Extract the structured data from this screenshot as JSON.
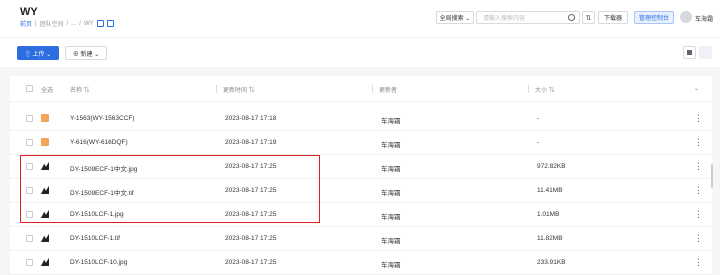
{
  "header": {
    "title": "WY",
    "breadcrumb": [
      "前页",
      "|",
      "团队空间",
      "/",
      "...",
      "/",
      "WY"
    ],
    "search_scope": "全局搜索 ⌄",
    "search_placeholder": "请输入搜索内容",
    "filter_label": "⇅",
    "download_label": "下载器",
    "admin_label": "管理控制台",
    "user_name": "车海霜"
  },
  "toolbar": {
    "upload_label": "⇧ 上传 ⌄",
    "new_label": "⊕ 新建 ⌄"
  },
  "table": {
    "headers": {
      "select_all": "全选",
      "name": "名称 ⇅",
      "updated": "更新时间 ⇅",
      "updater": "更新者",
      "size": "大小 ⇅",
      "more": "⌄"
    },
    "rows": [
      {
        "icon": "folder-icon",
        "name": "Y-1563(WY-1563CCF)",
        "updated": "2023-08-17 17:18",
        "updater": "车海霜",
        "size": "-"
      },
      {
        "icon": "folder-icon",
        "name": "Y-616(WY-616DQF)",
        "updated": "2023-08-17 17:19",
        "updater": "车海霜",
        "size": "-"
      },
      {
        "icon": "image-icon",
        "name": "DY-1509ECF-1中文.jpg",
        "updated": "2023-08-17 17:25",
        "updater": "车海霜",
        "size": "972.82KB"
      },
      {
        "icon": "image-icon",
        "name": "DY-1509ECF-1中文.tif",
        "updated": "2023-08-17 17:25",
        "updater": "车海霜",
        "size": "11.41MB"
      },
      {
        "icon": "image-icon",
        "name": "DY-1510LCF-1.jpg",
        "updated": "2023-08-17 17:25",
        "updater": "车海霜",
        "size": "1.01MB"
      },
      {
        "icon": "image-icon",
        "name": "DY-1510LCF-1.tif",
        "updated": "2023-08-17 17:25",
        "updater": "车海霜",
        "size": "11.82MB"
      },
      {
        "icon": "image-icon",
        "name": "DY-1510LCF-10.jpg",
        "updated": "2023-08-17 17:25",
        "updater": "车海霜",
        "size": "233.91KB"
      }
    ],
    "more_glyph": "⋮"
  }
}
